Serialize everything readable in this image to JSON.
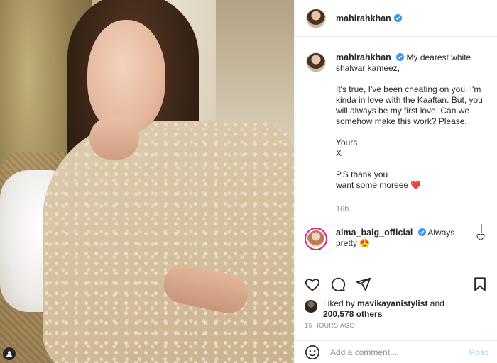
{
  "post": {
    "author": "mahirahkhan",
    "colors": {
      "verified": "#3897f0",
      "link_blue": "#b2dffc",
      "ring": "#d6249f",
      "heart_red": "#ed4956"
    }
  },
  "caption": {
    "username": "mahirahkhan",
    "line1": "My dearest white shalwar kameez,",
    "para1": "It's true, I've been cheating on you. I'm kinda in love with the Kaaftan. But, you will always be my first love. Can we somehow make this work? Please.",
    "yours": "Yours",
    "x": "X",
    "ps": "P.S thank you",
    "ps2": "want some moreee",
    "time_ago": "16h",
    "emoji": "❤️"
  },
  "comment": {
    "username": "aima_baig_official",
    "text": "Always pretty",
    "emoji": "😍"
  },
  "likes": {
    "liked_by_prefix": "Liked by",
    "liked_by_user": "mavikayanistylist",
    "and_text": "and",
    "count": "200,578 others"
  },
  "timestamp": "16 HOURS AGO",
  "add_comment": {
    "placeholder": "Add a comment...",
    "post_label": "Post"
  },
  "icons": [
    "heart-icon",
    "comment-icon",
    "share-icon",
    "bookmark-icon",
    "emoji-icon",
    "verified-icon",
    "user-icon"
  ]
}
